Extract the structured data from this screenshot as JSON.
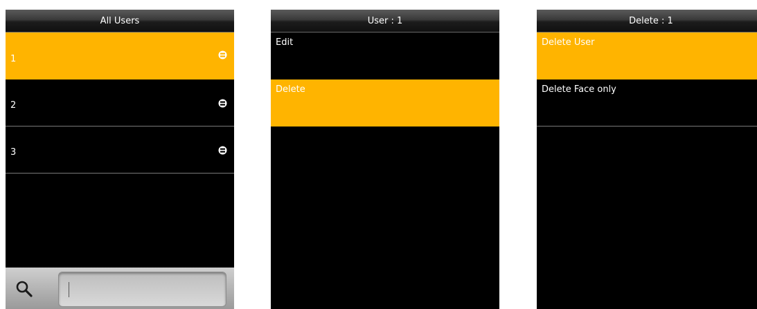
{
  "screens": [
    {
      "title": "All Users",
      "users": [
        {
          "id": "1",
          "selected": true,
          "icon": "face-icon"
        },
        {
          "id": "2",
          "selected": false,
          "icon": "face-icon"
        },
        {
          "id": "3",
          "selected": false,
          "icon": "face-icon"
        }
      ],
      "search": {
        "value": "",
        "icon": "search-icon"
      }
    },
    {
      "title": "User : 1",
      "items": [
        {
          "label": "Edit",
          "selected": false
        },
        {
          "label": "Delete",
          "selected": true
        }
      ]
    },
    {
      "title": "Delete : 1",
      "items": [
        {
          "label": "Delete User",
          "selected": true
        },
        {
          "label": "Delete Face only",
          "selected": false
        }
      ]
    }
  ],
  "colors": {
    "highlight": "#ffb400",
    "background": "#000000",
    "text": "#ffffff"
  }
}
